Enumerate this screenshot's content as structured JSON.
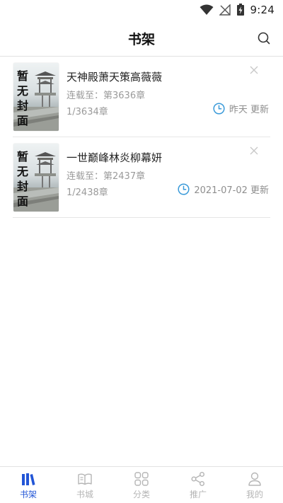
{
  "status_bar": {
    "time": "9:24"
  },
  "header": {
    "title": "书架"
  },
  "books": [
    {
      "title": "天神殿萧天策高薇薇",
      "latest": "连载至：第3636章",
      "progress": "1/3634章",
      "updated": "昨天 更新",
      "cover_text": "暂无封面"
    },
    {
      "title": "一世巅峰林炎柳幕妍",
      "latest": "连载至：第2437章",
      "progress": "1/2438章",
      "updated": "2021-07-02 更新",
      "cover_text": "暂无封面"
    }
  ],
  "tabbar": {
    "items": [
      {
        "label": "书架",
        "icon": "bookshelf-icon",
        "active": true
      },
      {
        "label": "书城",
        "icon": "open-book-icon",
        "active": false
      },
      {
        "label": "分类",
        "icon": "grid-icon",
        "active": false
      },
      {
        "label": "推广",
        "icon": "share-icon",
        "active": false
      },
      {
        "label": "我的",
        "icon": "user-icon",
        "active": false
      }
    ]
  },
  "colors": {
    "accent": "#2255d6",
    "clock": "#3a9ad9",
    "muted": "#9a9a9a",
    "divider": "#e6e6e6"
  }
}
